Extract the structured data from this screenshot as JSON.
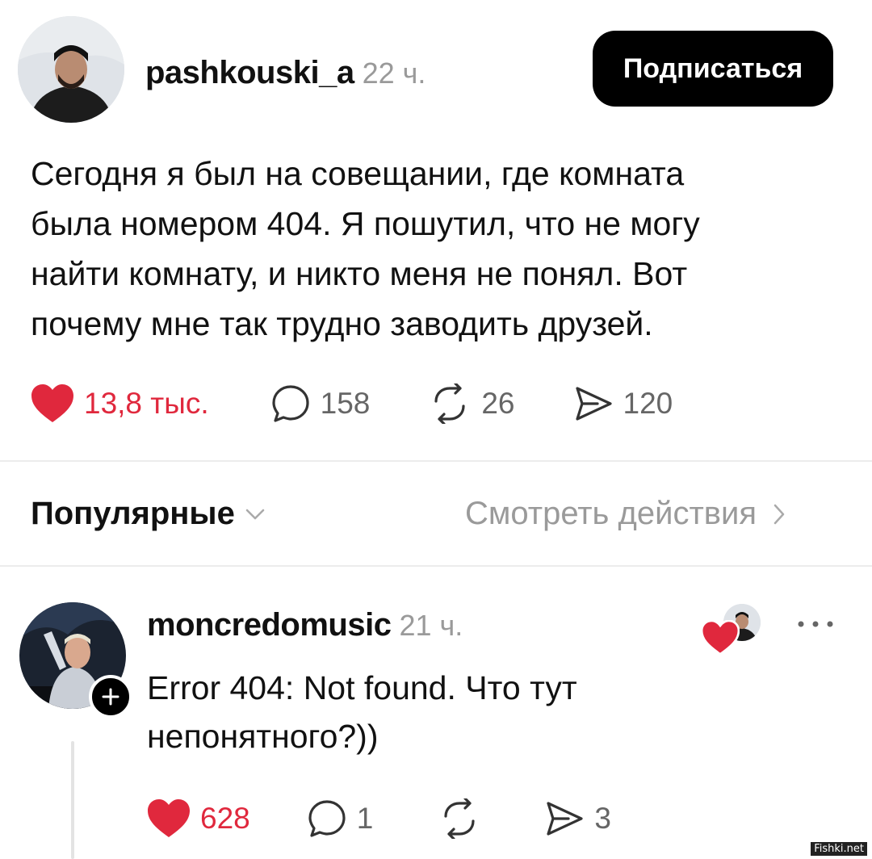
{
  "post": {
    "username": "pashkouski_a",
    "time": "22 ч.",
    "follow_label": "Подписаться",
    "text": "Сегодня я был на совещании, где комната\nбыла номером 404. Я пошутил, что не могу\nнайти комнату, и никто меня не понял. Вот\nпочему мне так трудно заводить друзей.",
    "likes": "13,8 тыс.",
    "comments": "158",
    "reposts": "26",
    "shares": "120"
  },
  "sort": {
    "label": "Популярные",
    "activity_link": "Смотреть действия"
  },
  "reply": {
    "username": "moncredomusic",
    "time": "21 ч.",
    "text": "Error 404: Not found. Что тут\nнепонятного?))",
    "likes": "628",
    "comments": "1",
    "reposts": "",
    "shares": "3"
  },
  "watermark": "Fishki.net",
  "colors": {
    "like_red": "#e0283d",
    "follow_bg": "#000000",
    "muted": "#9a9a9a"
  },
  "icons": [
    "heart-icon",
    "comment-icon",
    "repost-icon",
    "share-icon",
    "chevron-down-icon",
    "chevron-right-icon",
    "more-icon",
    "plus-icon"
  ]
}
